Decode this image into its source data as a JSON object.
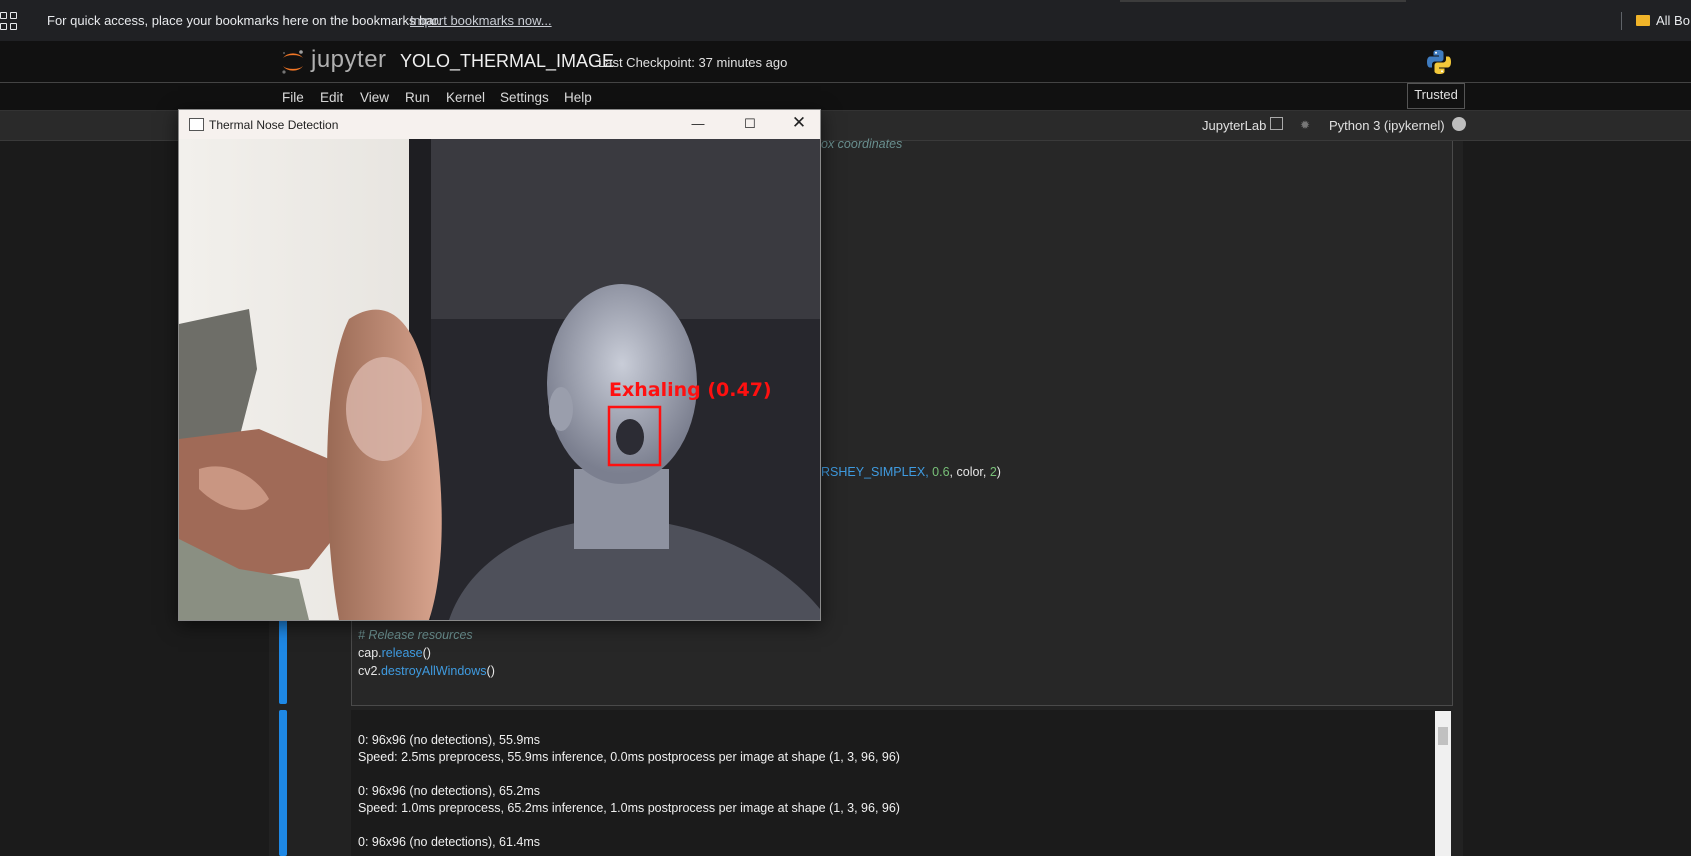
{
  "bookmarks_bar": {
    "message": "For quick access, place your bookmarks here on the bookmarks bar.",
    "import_link": "Import bookmarks now...",
    "all_bookmarks": "All Bo"
  },
  "jupyter": {
    "wordmark": "jupyter",
    "notebook_title": "YOLO_THERMAL_IMAGE",
    "checkpoint": "Last Checkpoint: 37 minutes ago",
    "trusted": "Trusted",
    "jupyterlab_link": "JupyterLab",
    "kernel_name": "Python 3 (ipykernel)"
  },
  "menu": {
    "items": [
      "File",
      "Edit",
      "View",
      "Run",
      "Kernel",
      "Settings",
      "Help"
    ]
  },
  "code_cell": {
    "partial_comment": "ox coordinates",
    "partial_line": {
      "prefix": "RSHEY_SIMPLEX, ",
      "num1": "0.6",
      "mid": ", color, ",
      "num2": "2",
      "suffix": ")"
    },
    "release_comment": "# Release resources",
    "cap_obj": "cap.",
    "cap_fn": "release",
    "cap_args": "()",
    "cv2_obj": "cv2.",
    "cv2_fn": "destroyAllWindows",
    "cv2_args": "()"
  },
  "output_lines": [
    "0: 96x96 (no detections), 55.9ms",
    "Speed: 2.5ms preprocess, 55.9ms inference, 0.0ms postprocess per image at shape (1, 3, 96, 96)",
    "0: 96x96 (no detections), 65.2ms",
    "Speed: 1.0ms preprocess, 65.2ms inference, 1.0ms postprocess per image at shape (1, 3, 96, 96)",
    "0: 96x96 (no detections), 61.4ms"
  ],
  "cv_window": {
    "title": "Thermal Nose Detection",
    "detection_label": "Exhaling (0.47)"
  },
  "colors": {
    "cell_accent": "#1e88e5",
    "detection_box": "#ff1010",
    "jupyter_orange": "#f37726"
  }
}
